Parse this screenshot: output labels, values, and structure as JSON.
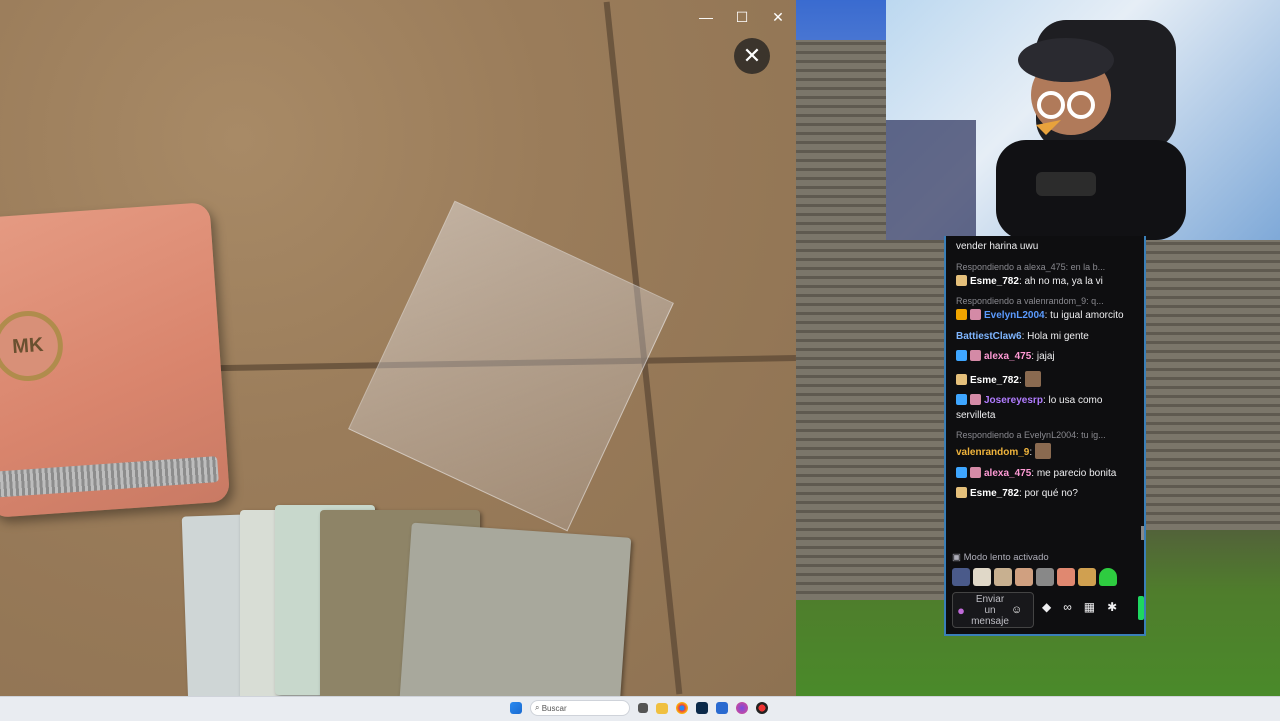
{
  "viewer": {
    "close_glyph": "✕",
    "window_controls": [
      "—",
      "☐",
      "✕"
    ],
    "wallet_logo": "MK"
  },
  "chat": {
    "messages": [
      {
        "reply": "",
        "user": "",
        "color": "#efeff1",
        "text": "vender harina uwu",
        "badges": []
      },
      {
        "reply": "Respondiendo a alexa_475: en la b...",
        "user": "Esme_782",
        "color": "#ffffff",
        "text": "ah no ma, ya la vi",
        "badges": [
          "#e5c07b"
        ]
      },
      {
        "reply": "Respondiendo a valenrandom_9: q...",
        "user": "EvelynL2004",
        "color": "#5b9bff",
        "text": "tu igual amorcito",
        "badges": [
          "#f0a500",
          "#d48aa6"
        ]
      },
      {
        "reply": "",
        "user": "BattiestClaw6",
        "color": "#7fb6ff",
        "text": "Hola mi gente",
        "badges": []
      },
      {
        "reply": "",
        "user": "alexa_475",
        "color": "#ff9ad5",
        "text": "jajaj",
        "badges": [
          "#3ea6ff",
          "#d48aa6"
        ]
      },
      {
        "reply": "",
        "user": "Esme_782",
        "color": "#ffffff",
        "text": "",
        "badges": [
          "#e5c07b"
        ]
      },
      {
        "reply": "",
        "user": "Josereyesrp",
        "color": "#b17cff",
        "text": "lo usa como servilleta",
        "badges": [
          "#3ea6ff",
          "#d48aa6"
        ]
      },
      {
        "reply": "Respondiendo a EvelynL2004: tu ig...",
        "user": "valenrandom_9",
        "color": "#f0b43c",
        "text": "",
        "badges": []
      },
      {
        "reply": "",
        "user": "alexa_475",
        "color": "#ff9ad5",
        "text": "me parecio bonita",
        "badges": [
          "#3ea6ff",
          "#d48aa6"
        ]
      },
      {
        "reply": "",
        "user": "Esme_782",
        "color": "#ffffff",
        "text": "por qué no?",
        "badges": [
          "#e5c07b"
        ]
      }
    ],
    "slow_mode": "Modo lento activado",
    "input_placeholder": "Enviar un mensaje",
    "icons": [
      "bits-icon",
      "infinity-icon",
      "gift-icon",
      "settings-icon"
    ]
  },
  "taskbar": {
    "search_placeholder": "Buscar",
    "icons": [
      "windows-start-icon",
      "search-icon",
      "task-view-icon",
      "file-explorer-icon",
      "chrome-icon",
      "photoshop-icon",
      "store-icon",
      "browser-icon",
      "recording-icon"
    ]
  },
  "colors": {
    "chat_bg": "#0e0e10",
    "chat_border": "#3a7fb8",
    "taskbar_bg": "#e9ecf1"
  }
}
